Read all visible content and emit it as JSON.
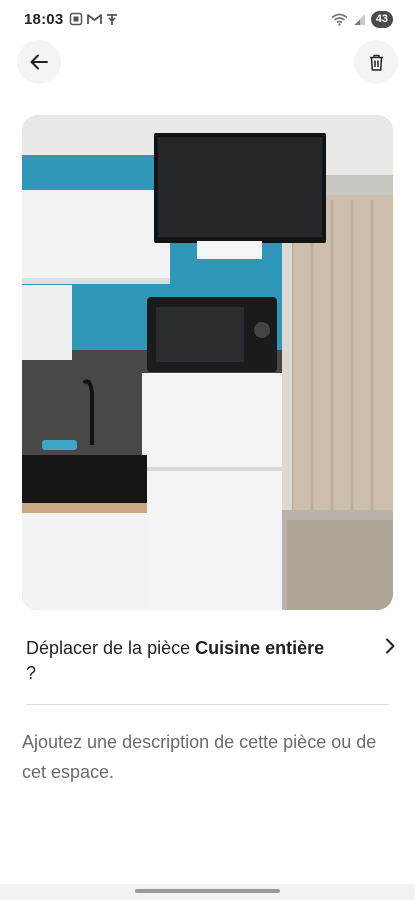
{
  "status_bar": {
    "time": "18:03",
    "battery": "43",
    "left_icons": [
      "screenshot-icon",
      "gmail-icon",
      "antenna-icon"
    ],
    "right_icons": [
      "wifi-icon",
      "signal-icon"
    ]
  },
  "nav": {
    "back_icon": "arrow-left-icon",
    "delete_icon": "trash-icon"
  },
  "photo": {
    "subject": "room-photo"
  },
  "room_move": {
    "prefix": "Déplacer de la pièce ",
    "room_name": "Cuisine entière",
    "suffix": " ?"
  },
  "description": {
    "placeholder": "Ajoutez une description de cette pièce ou de cet espace."
  }
}
